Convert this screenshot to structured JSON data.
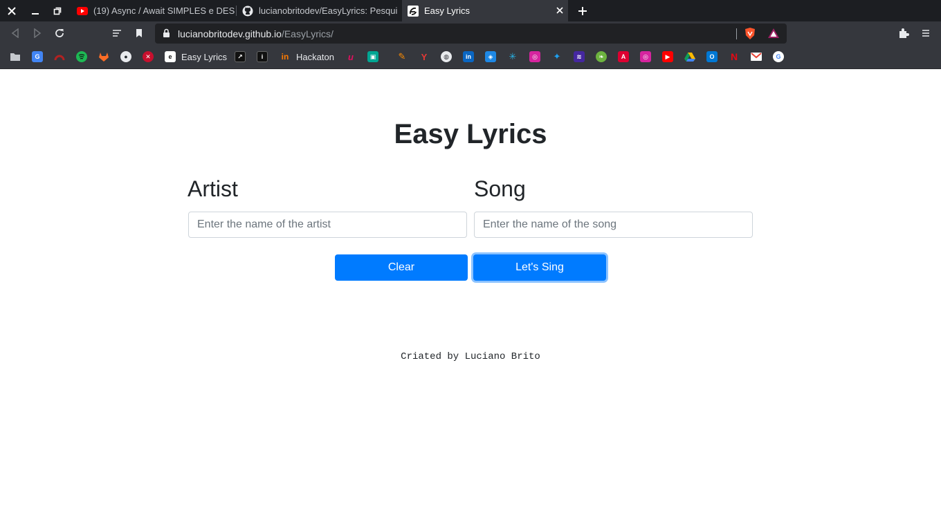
{
  "colors": {
    "primary": "#007bff",
    "chrome_dark": "#1c1e22",
    "chrome": "#35373d"
  },
  "tabs": [
    {
      "title": "(19) Async / Await SIMPLES e DESC",
      "icon": "youtube-icon",
      "active": false
    },
    {
      "title": "lucianobritodev/EasyLyrics: Pesqui",
      "icon": "github-icon",
      "active": false
    },
    {
      "title": "Easy Lyrics",
      "icon": "easy-lyrics-icon",
      "active": true
    }
  ],
  "address": {
    "host": "lucianobritodev.github.io",
    "path": "/EasyLyrics/"
  },
  "bookmarks": [
    {
      "label": "Easy Lyrics",
      "icon": "easy-lyrics-icon"
    },
    {
      "label": "Hackaton",
      "icon": "hackaton-icon"
    }
  ],
  "app": {
    "title": "Easy Lyrics",
    "artist_label": "Artist",
    "artist_placeholder": "Enter the name of the artist",
    "song_label": "Song",
    "song_placeholder": "Enter the name of the song",
    "clear_label": "Clear",
    "sing_label": "Let's Sing",
    "footer": "Criated by Luciano Brito"
  }
}
